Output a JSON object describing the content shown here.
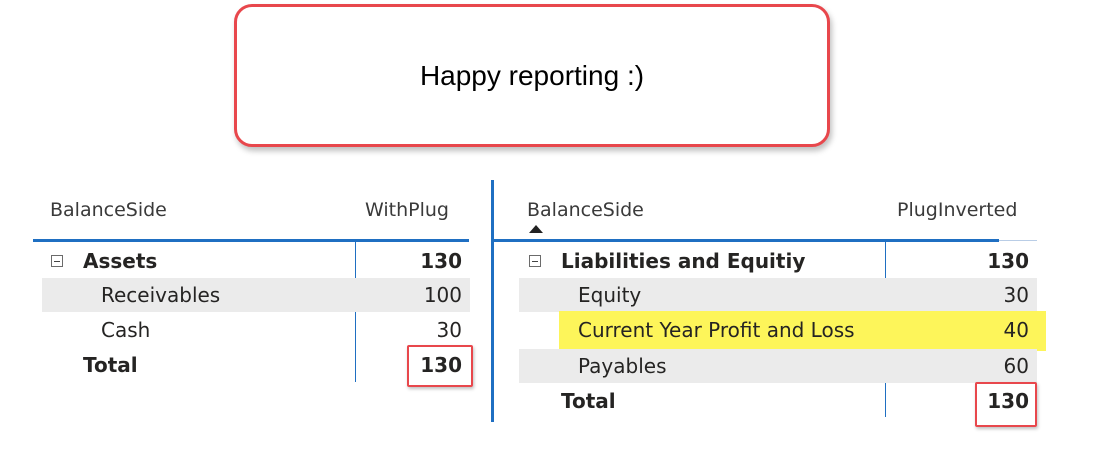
{
  "callout": {
    "text": "Happy reporting :)"
  },
  "left_table": {
    "headers": {
      "group": "BalanceSide",
      "value": "WithPlug"
    },
    "parent": {
      "label": "Assets",
      "value": "130"
    },
    "rows": [
      {
        "label": "Receivables",
        "value": "100"
      },
      {
        "label": "Cash",
        "value": "30"
      }
    ],
    "total": {
      "label": "Total",
      "value": "130"
    }
  },
  "right_table": {
    "headers": {
      "group": "BalanceSide",
      "value": "PlugInverted"
    },
    "sort": "ascending",
    "parent": {
      "label": "Liabilities and Equitiy",
      "value": "130"
    },
    "rows": [
      {
        "label": "Equity",
        "value": "30"
      },
      {
        "label": "Current Year Profit and Loss",
        "value": "40"
      },
      {
        "label": "Payables",
        "value": "60"
      }
    ],
    "total": {
      "label": "Total",
      "value": "130"
    }
  },
  "colors": {
    "accent": "#1f6fc2",
    "highlight": "#fdf55a",
    "callout_border": "#e8474c"
  }
}
